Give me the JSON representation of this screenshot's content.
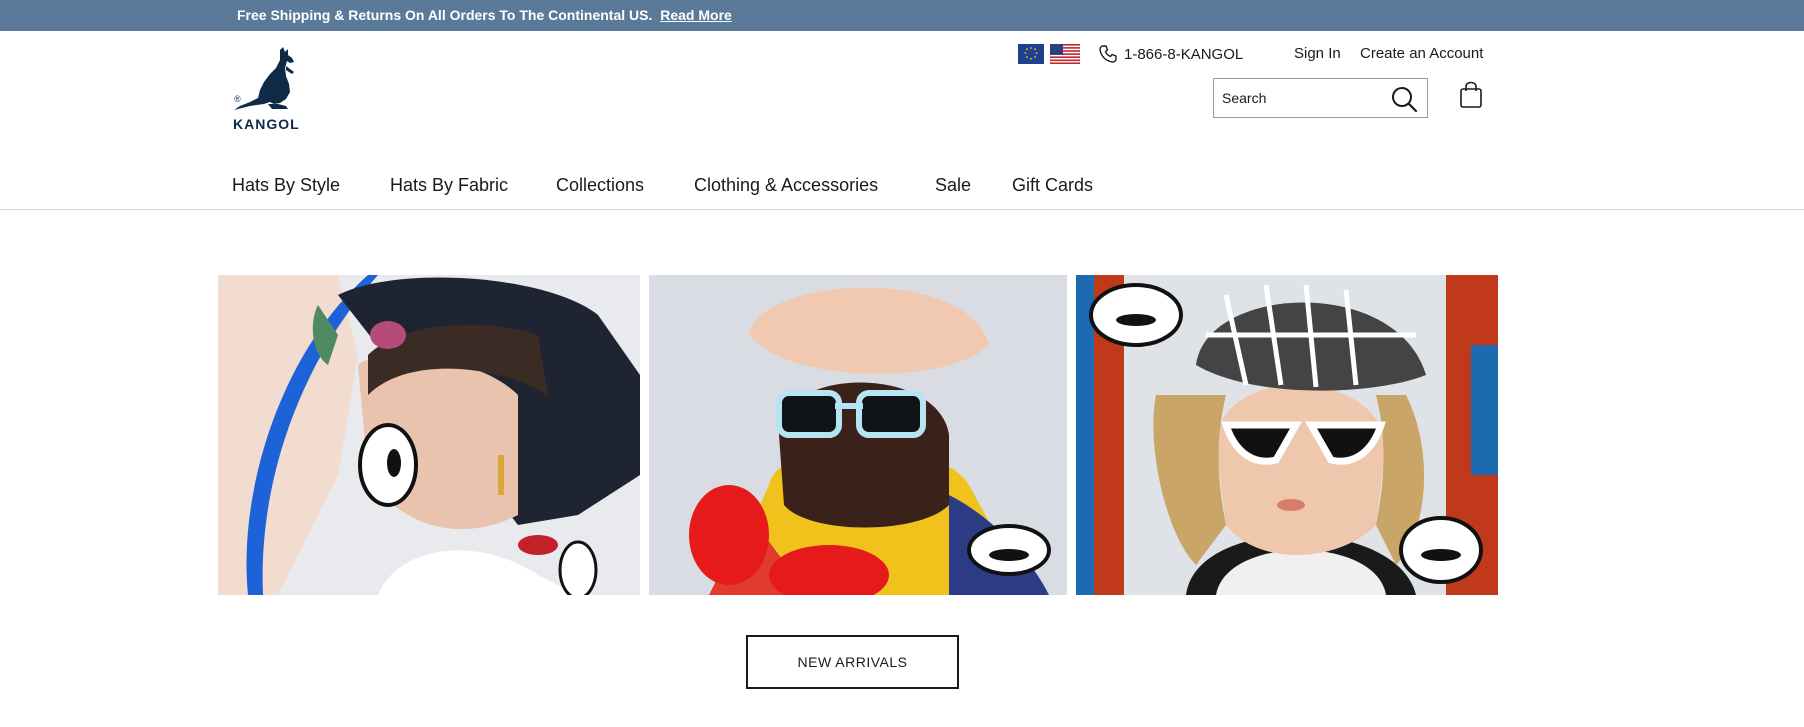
{
  "promo": {
    "text": "Free Shipping & Returns On All Orders To The Continental US.",
    "link": "Read More"
  },
  "brand": {
    "logo_text": "KANGOL",
    "logo_mark": "®",
    "color": "#0e2a47"
  },
  "header": {
    "flags": [
      "eu-flag-icon",
      "us-flag-icon"
    ],
    "phone": "1-866-8-KANGOL",
    "sign_in": "Sign In",
    "create_account": "Create an Account",
    "search_placeholder": "Search"
  },
  "nav": {
    "items": [
      {
        "label": "Hats By Style"
      },
      {
        "label": "Hats By Fabric"
      },
      {
        "label": "Collections"
      },
      {
        "label": "Clothing & Accessories"
      },
      {
        "label": "Sale"
      },
      {
        "label": "Gift Cards"
      }
    ]
  },
  "hero": {
    "images": [
      "hero-image-1",
      "hero-image-2",
      "hero-image-3"
    ],
    "cta": "NEW ARRIVALS"
  },
  "colors": {
    "promo_bar": "#5b7a99",
    "text": "#1a1a1a"
  }
}
